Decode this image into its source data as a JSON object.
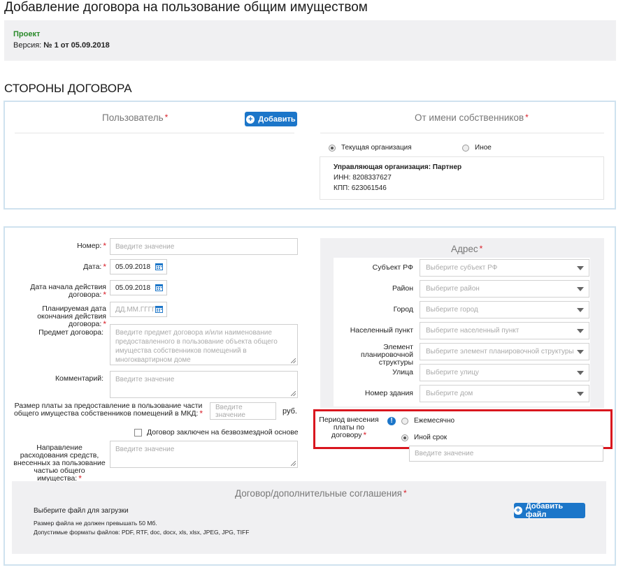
{
  "page_title": "Добавление договора на пользование общим имуществом",
  "project": {
    "status": "Проект",
    "version_label": "Версия:",
    "version_value": "№ 1 от 05.09.2018"
  },
  "parties": {
    "heading": "СТОРОНЫ ДОГОВОРА",
    "user_label": "Пользователь",
    "add_button": "Добавить",
    "owners_label": "От имени собственников",
    "option_current": "Текущая организация",
    "option_other": "Иное",
    "org_title": "Управляющая организация: Партнер",
    "inn": "ИНН: 8208337627",
    "kpp": "КПП: 623061546"
  },
  "form": {
    "number": {
      "label": "Номер:",
      "placeholder": "Введите значение"
    },
    "date": {
      "label": "Дата:",
      "value": "05.09.2018"
    },
    "start_date": {
      "label": "Дата начала действия договора:",
      "value": "05.09.2018"
    },
    "end_date": {
      "label": "Планируемая дата окончания действия договора:",
      "placeholder": "ДД.ММ.ГГГГ"
    },
    "subject": {
      "label": "Предмет договора:",
      "placeholder": "Введите предмет договора и/или наименование предоставленного в пользование объекта общего имущества собственников помещений в многоквартирном доме"
    },
    "comment": {
      "label": "Комментарий:",
      "placeholder": "Введите значение"
    },
    "fee": {
      "label": "Размер платы за предоставление в пользование части общего имущества собственников помещений в МКД:",
      "placeholder": "Введите значение",
      "unit": "руб."
    },
    "free_checkbox": "Договор заключен на безвозмездной основе",
    "direction": {
      "label": "Направление расходования средств, внесенных за пользование частью общего имущества:",
      "placeholder": "Введите значение"
    }
  },
  "address": {
    "heading": "Адрес",
    "fields": [
      {
        "label": "Субъект РФ",
        "placeholder": "Выберите субъект РФ"
      },
      {
        "label": "Район",
        "placeholder": "Выберите район"
      },
      {
        "label": "Город",
        "placeholder": "Выберите город"
      },
      {
        "label": "Населенный пункт",
        "placeholder": "Выберите населенный пункт"
      },
      {
        "label": "Элемент планировочной структуры",
        "placeholder": "Выберите элемент планировочной структуры"
      },
      {
        "label": "Улица",
        "placeholder": "Выберите улицу"
      },
      {
        "label": "Номер здания",
        "placeholder": "Выберите дом"
      }
    ]
  },
  "payment_period": {
    "label": "Период внесения платы по договору",
    "option_monthly": "Ежемесячно",
    "option_other": "Иной срок",
    "input_placeholder": "Введите значение",
    "highlight_color": "#d9161e"
  },
  "documents": {
    "heading": "Договор/дополнительные соглашения",
    "choose": "Выберите файл для загрузки",
    "size_note": "Размер файла не должен превышать 50 Мб.",
    "formats": "Допустимые форматы файлов: PDF, RTF, doc, docx, xls, xlsx, JPEG, JPG, TIFF",
    "add_file_button": "Добавить файл"
  },
  "colors": {
    "accent": "#1c76c9",
    "panel_border": "#cfe2ef",
    "required": "#d9202a"
  }
}
